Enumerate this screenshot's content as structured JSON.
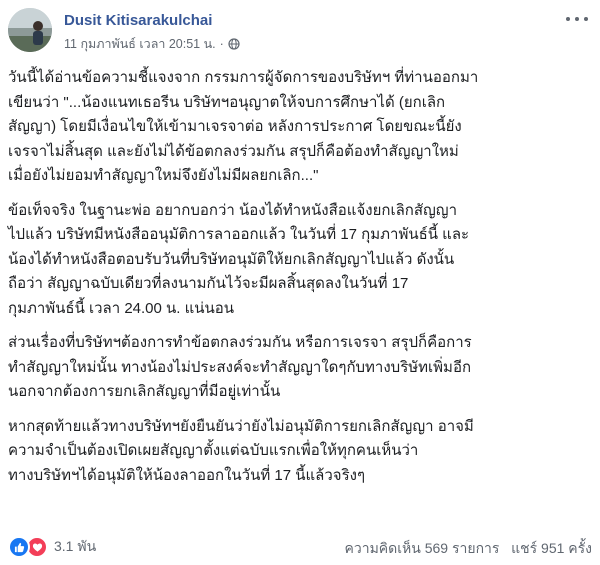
{
  "post": {
    "author": "Dusit Kitisarakulchai",
    "timestamp": "11 กุมภาพันธ์ เวลา 20:51 น.",
    "separator": "·",
    "paragraphs": [
      "วันนี้ได้อ่านข้อความชี้แจงจาก กรรมการผู้จัดการของบริษัทฯ ที่ท่านออกมา\nเขียนว่า \"...น้องแนทเธอรีน บริษัทฯอนุญาตให้จบการศึกษาได้ (ยกเลิก\nสัญญา) โดยมีเงื่อนไขให้เข้ามาเจรจาต่อ หลังการประกาศ โดยขณะนี้ยัง\nเจรจาไม่สิ้นสุด และยังไม่ได้ข้อตกลงร่วมกัน สรุปก็คือต้องทำสัญญาใหม่\nเมื่อยังไม่ยอมทำสัญญาใหม่จึงยังไม่มีผลยกเลิก...\"",
      "ข้อเท็จจริง ในฐานะพ่อ อยากบอกว่า น้องได้ทำหนังสือแจ้งยกเลิกสัญญา\nไปแล้ว บริษัทมีหนังสืออนุมัติการลาออกแล้ว ในวันที่ 17 กุมภาพันธ์นี้ และ\nน้องได้ทำหนังสือตอบรับวันที่บริษัทอนุมัติให้ยกเลิกสัญญาไปแล้ว ดังนั้น\nถือว่า สัญญาฉบับเดียวที่ลงนามกันไว้จะมีผลสิ้นสุดลงในวันที่ 17\nกุมภาพันธ์นี้ เวลา 24.00 น. แน่นอน",
      "ส่วนเรื่องที่บริษัทฯต้องการทำข้อตกลงร่วมกัน หรือการเจรจา สรุปก็คือการ\nทำสัญญาใหม่นั้น ทางน้องไม่ประสงค์จะทำสัญญาใดๆกับทางบริษัทเพิ่มอีก\nนอกจากต้องการยกเลิกสัญญาที่มีอยู่เท่านั้น",
      "หากสุดท้ายแล้วทางบริษัทฯยังยืนยันว่ายังไม่อนุมัติการยกเลิกสัญญา อาจมี\nความจำเป็นต้องเปิดเผยสัญญาตั้งแต่ฉบับแรกเพื่อให้ทุกคนเห็นว่า\nทางบริษัทฯได้อนุมัติให้น้องลาออกในวันที่ 17 นี้แล้วจริงๆ"
    ]
  },
  "footer": {
    "reaction_count": "3.1 พัน",
    "comments": "ความคิดเห็น 569 รายการ",
    "shares": "แชร์ 951 ครั้ง"
  },
  "icons": {
    "avatar": "profile-photo",
    "privacy": "globe-icon",
    "menu": "more-options-icon",
    "like": "like-icon",
    "love": "love-icon"
  },
  "colors": {
    "author_link": "#385898",
    "meta_text": "#606770",
    "body_text": "#1c1e21",
    "like_blue": "#1877f2",
    "love_red": "#f33e58"
  }
}
